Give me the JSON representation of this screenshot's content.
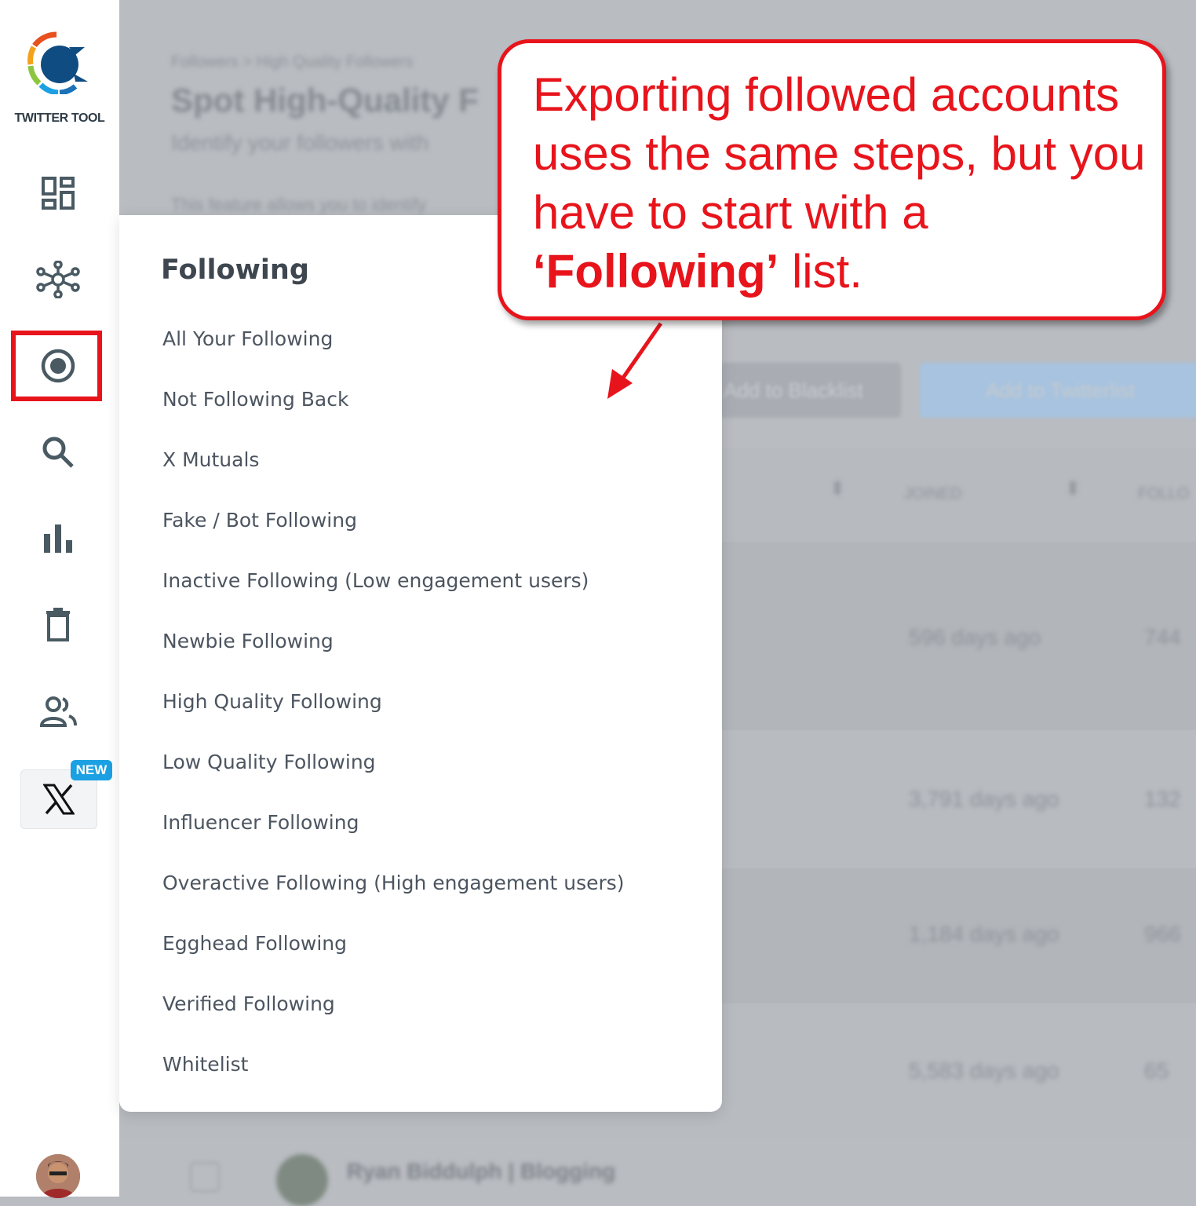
{
  "brand": {
    "name": "TWITTER TOOL"
  },
  "nav": {
    "items": [
      {
        "icon": "dashboard-icon"
      },
      {
        "icon": "network-icon"
      },
      {
        "icon": "target-icon",
        "active": true
      },
      {
        "icon": "search-icon"
      },
      {
        "icon": "bar-chart-icon"
      },
      {
        "icon": "trash-icon"
      },
      {
        "icon": "users-icon"
      },
      {
        "icon": "x-logo-icon",
        "badge": "NEW"
      }
    ],
    "active_highlight_color": "#e8141c"
  },
  "background": {
    "breadcrumb": "Followers > High Quality Followers",
    "heading": "Spot High-Quality F",
    "subtitle": "Identify your followers with",
    "description": "This feature allows you to identify",
    "btn_blacklist": "Add to Blacklist",
    "btn_twitterlist": "Add to Twitterlist",
    "col_joined": "JOINED",
    "col_follo": "FOLLO",
    "rows": [
      {
        "joined": "596 days ago",
        "followers": "744"
      },
      {
        "joined": "3,791 days ago",
        "followers": "132"
      },
      {
        "joined": "1,184 days ago",
        "followers": "966"
      },
      {
        "joined": "5,583 days ago",
        "followers": "65"
      }
    ],
    "last_row_name": "Ryan Biddulph | Blogging"
  },
  "dropdown": {
    "title": "Following",
    "items": [
      "All Your Following",
      "Not Following Back",
      "X Mutuals",
      "Fake / Bot Following",
      "Inactive Following (Low engagement users)",
      "Newbie Following",
      "High Quality Following",
      "Low Quality Following",
      "Influencer Following",
      "Overactive Following (High engagement users)",
      "Egghead Following",
      "Verified Following",
      "Whitelist"
    ]
  },
  "callout": {
    "text_part1": "Exporting followed accounts uses the same steps, but you have to start with a ",
    "text_bold": "‘Following’",
    "text_part2": " list.",
    "color": "#e8141c"
  }
}
